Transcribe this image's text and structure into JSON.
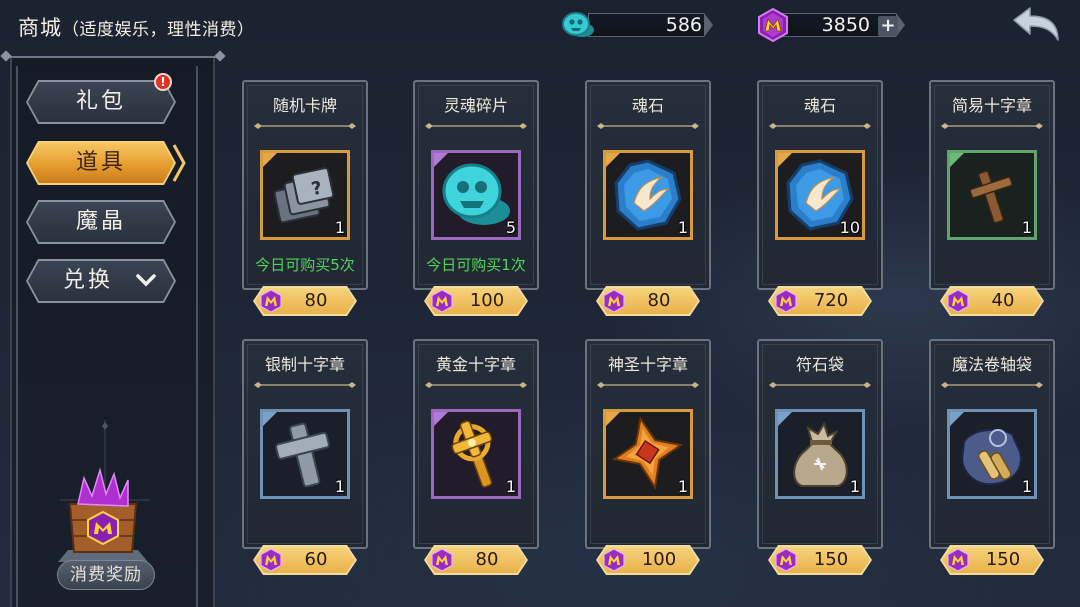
{
  "header": {
    "title": "商城",
    "subtitle": "（适度娱乐，理性消费）",
    "soul_currency": "586",
    "gem_currency": "3850"
  },
  "icons": {
    "soul_currency": "teal-skull-coin-icon",
    "gem_currency": "purple-m-gem-icon",
    "plus": "plus-icon",
    "back": "back-arrow-icon",
    "alert": "exclamation-badge-icon",
    "dropdown": "chevron-down-icon"
  },
  "sidebar": {
    "tabs": [
      {
        "label": "礼包",
        "badge": "!"
      },
      {
        "label": "道具",
        "active": true
      },
      {
        "label": "魔晶"
      },
      {
        "label": "兑换"
      }
    ],
    "reward_label": "消费奖励"
  },
  "colors": {
    "accent": "#e9a83c",
    "limit_text": "#52d45a",
    "gem_purple": "#b23bd6",
    "soul_teal": "#35c7cf"
  },
  "shop": {
    "items": [
      {
        "name": "随机卡牌",
        "icon": "card-stack-icon",
        "quantity": "1",
        "limit": "今日可购买5次",
        "price": "80",
        "rarity": "gold"
      },
      {
        "name": "灵魂碎片",
        "icon": "soul-shard-icon",
        "quantity": "5",
        "limit": "今日可购买1次",
        "price": "100",
        "rarity": "purple"
      },
      {
        "name": "魂石",
        "icon": "soul-stone-icon",
        "quantity": "1",
        "price": "80",
        "rarity": "gold"
      },
      {
        "name": "魂石",
        "icon": "soul-stone-icon",
        "quantity": "10",
        "price": "720",
        "rarity": "gold"
      },
      {
        "name": "简易十字章",
        "icon": "wooden-cross-icon",
        "quantity": "1",
        "price": "40",
        "rarity": "green"
      },
      {
        "name": "银制十字章",
        "icon": "silver-cross-icon",
        "quantity": "1",
        "price": "60",
        "rarity": "blue"
      },
      {
        "name": "黄金十字章",
        "icon": "golden-cross-icon",
        "quantity": "1",
        "price": "80",
        "rarity": "purple"
      },
      {
        "name": "神圣十字章",
        "icon": "holy-cross-icon",
        "quantity": "1",
        "price": "100",
        "rarity": "gold"
      },
      {
        "name": "符石袋",
        "icon": "rune-bag-icon",
        "quantity": "1",
        "price": "150",
        "rarity": "blue"
      },
      {
        "name": "魔法卷轴袋",
        "icon": "scroll-bag-icon",
        "quantity": "1",
        "price": "150",
        "rarity": "blue"
      }
    ]
  }
}
